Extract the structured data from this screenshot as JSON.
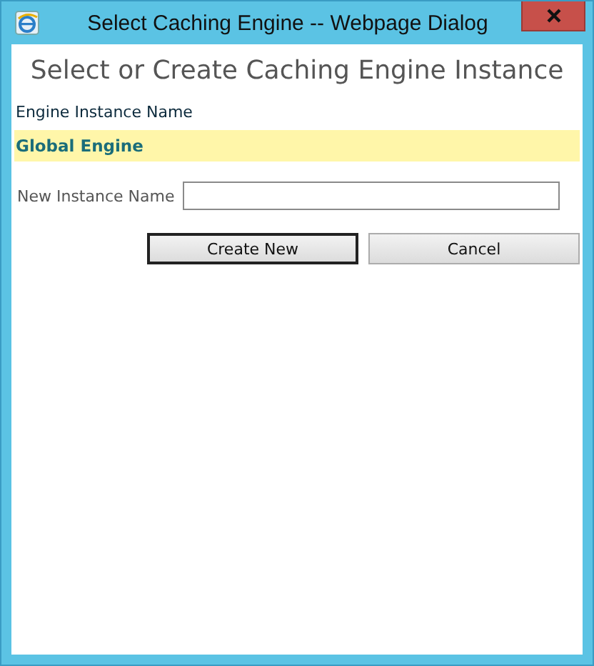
{
  "window": {
    "title": "Select Caching Engine -- Webpage Dialog"
  },
  "heading": "Select or Create Caching Engine Instance",
  "list": {
    "header": "Engine Instance Name",
    "items": [
      {
        "name": "Global Engine",
        "selected": true
      }
    ]
  },
  "new_instance": {
    "label": "New Instance Name"
  },
  "buttons": [
    {
      "label": "Create New",
      "default": true
    },
    {
      "label": "Cancel",
      "default": false
    }
  ]
}
